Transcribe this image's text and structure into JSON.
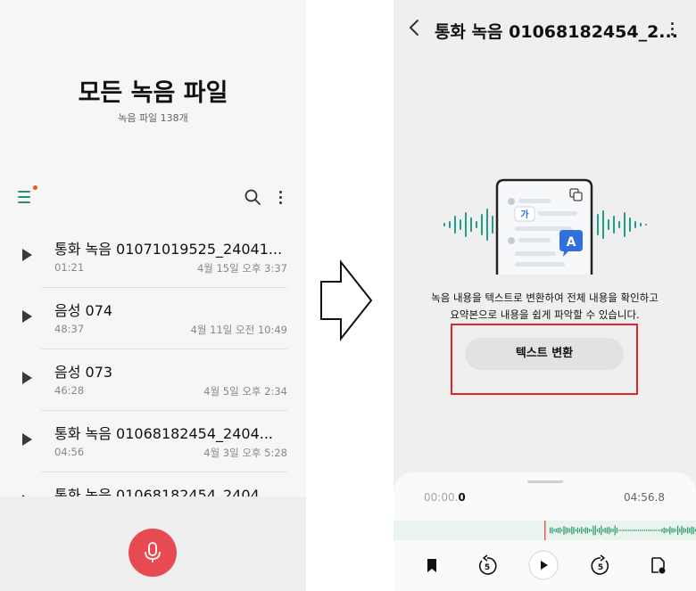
{
  "left": {
    "title": "모든 녹음 파일",
    "subtitle": "녹음 파일 138개",
    "recordings": [
      {
        "name": "통화 녹음 01071019525_24041...",
        "duration": "01:21",
        "date": "4월 15일 오후 3:37"
      },
      {
        "name": "음성 074",
        "duration": "48:37",
        "date": "4월 11일 오전 10:49"
      },
      {
        "name": "음성 073",
        "duration": "46:28",
        "date": "4월 5일 오후 2:34"
      },
      {
        "name": "통화 녹음 01068182454_2404...",
        "duration": "04:56",
        "date": "4월 3일 오후 5:28"
      },
      {
        "name": "통화 녹음 01068182454_2404",
        "duration": "",
        "date": ""
      }
    ]
  },
  "right": {
    "title": "통화 녹음 01068182454_2...",
    "description": [
      "녹음 내용을 텍스트로 변환하여 전체 내용을 확인하고",
      "요약본으로 내용을 쉽게 파악할 수 있습니다."
    ],
    "illustration": {
      "korean_glyph": "가",
      "latin_glyph": "A"
    },
    "convert_button": "텍스트 변환",
    "player": {
      "current_time_prefix": "00:00.",
      "current_time_bold": "0",
      "total_time": "04:56.8",
      "skip_back_seconds": "5",
      "skip_forward_seconds": "5"
    }
  },
  "colors": {
    "accent_green": "#2f8a68",
    "record_red": "#e84a52",
    "highlight_red": "#e0242c",
    "notification_orange": "#f05a1c",
    "illustration_blue": "#2f6fe0"
  },
  "icons": {
    "left_menu": "menu-icon",
    "left_search": "search-icon",
    "left_more": "more-vertical-icon",
    "row_play": "play-icon",
    "record": "mic-icon",
    "right_back": "chevron-left-icon",
    "right_more": "more-vertical-icon",
    "bookmark": "bookmark-icon",
    "rewind": "rewind-5-icon",
    "play": "play-icon",
    "forward": "forward-5-icon",
    "export": "export-file-icon"
  }
}
